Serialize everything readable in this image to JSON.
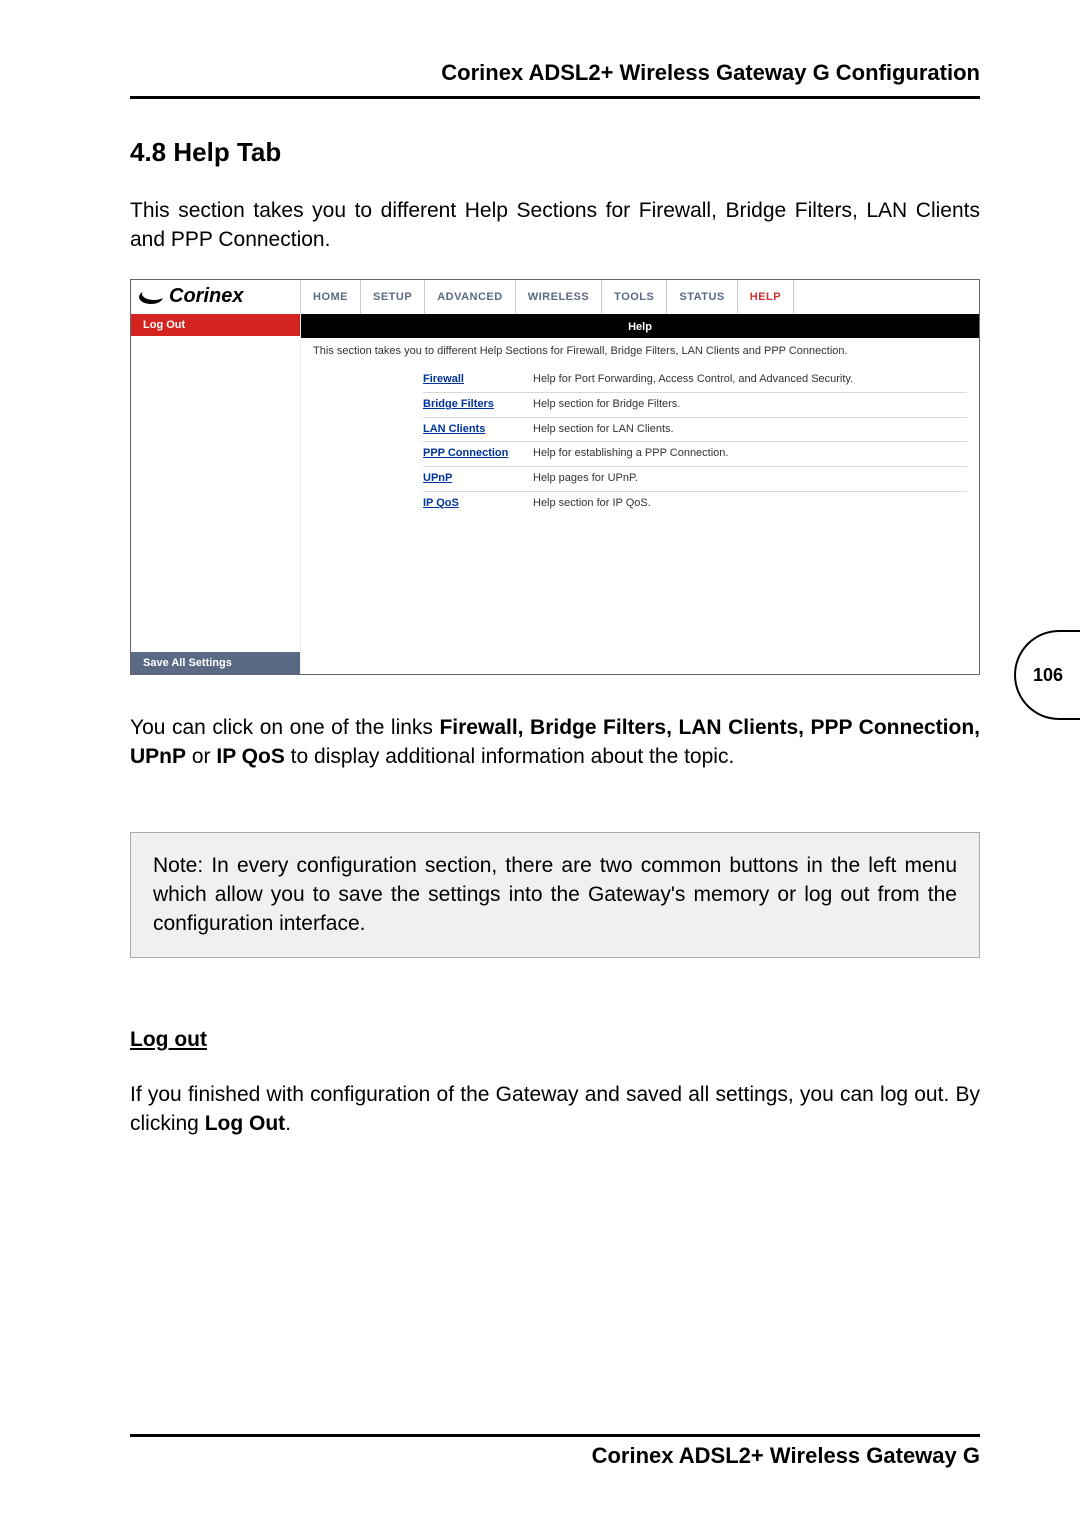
{
  "header": {
    "title": "Corinex ADSL2+ Wireless Gateway G Configuration"
  },
  "section": {
    "heading": "4.8 Help Tab"
  },
  "intro": "This section takes you to different Help Sections for Firewall, Bridge Filters, LAN Clients and PPP Connection.",
  "screenshot": {
    "logo": "Corinex",
    "nav": [
      "HOME",
      "SETUP",
      "ADVANCED",
      "WIRELESS",
      "TOOLS",
      "STATUS",
      "HELP"
    ],
    "active_nav": "HELP",
    "sidebar": {
      "logout": "Log Out",
      "save": "Save All Settings"
    },
    "content": {
      "title": "Help",
      "intro": "This section takes you to different Help Sections for Firewall, Bridge Filters, LAN Clients and PPP Connection.",
      "items": [
        {
          "link": "Firewall",
          "desc": "Help for Port Forwarding, Access Control, and Advanced Security."
        },
        {
          "link": "Bridge Filters",
          "desc": "Help section for Bridge Filters."
        },
        {
          "link": "LAN Clients",
          "desc": "Help section for LAN Clients."
        },
        {
          "link": "PPP Connection",
          "desc": "Help for establishing a PPP Connection."
        },
        {
          "link": "UPnP",
          "desc": "Help pages for UPnP."
        },
        {
          "link": "IP QoS",
          "desc": "Help section for IP QoS."
        }
      ]
    }
  },
  "page_number": "106",
  "after_shot": {
    "pre": "You can click on one of the links ",
    "bold": "Firewall, Bridge Filters, LAN Clients, PPP Connection, UPnP",
    "mid": "  or ",
    "bold2": "IP QoS",
    "post": " to display additional information about the topic."
  },
  "note": {
    "label": "Note",
    "body": ": In every configuration section, there are two common buttons in the left menu which allow you to save the settings into the Gateway's memory or log out from the configuration interface."
  },
  "logout_section": {
    "heading": "Log out",
    "pre": "If you finished with configuration of the Gateway and saved all settings, you can log out. By clicking ",
    "bold": "Log Out",
    "post": "."
  },
  "footer": {
    "title": "Corinex ADSL2+ Wireless Gateway G"
  }
}
